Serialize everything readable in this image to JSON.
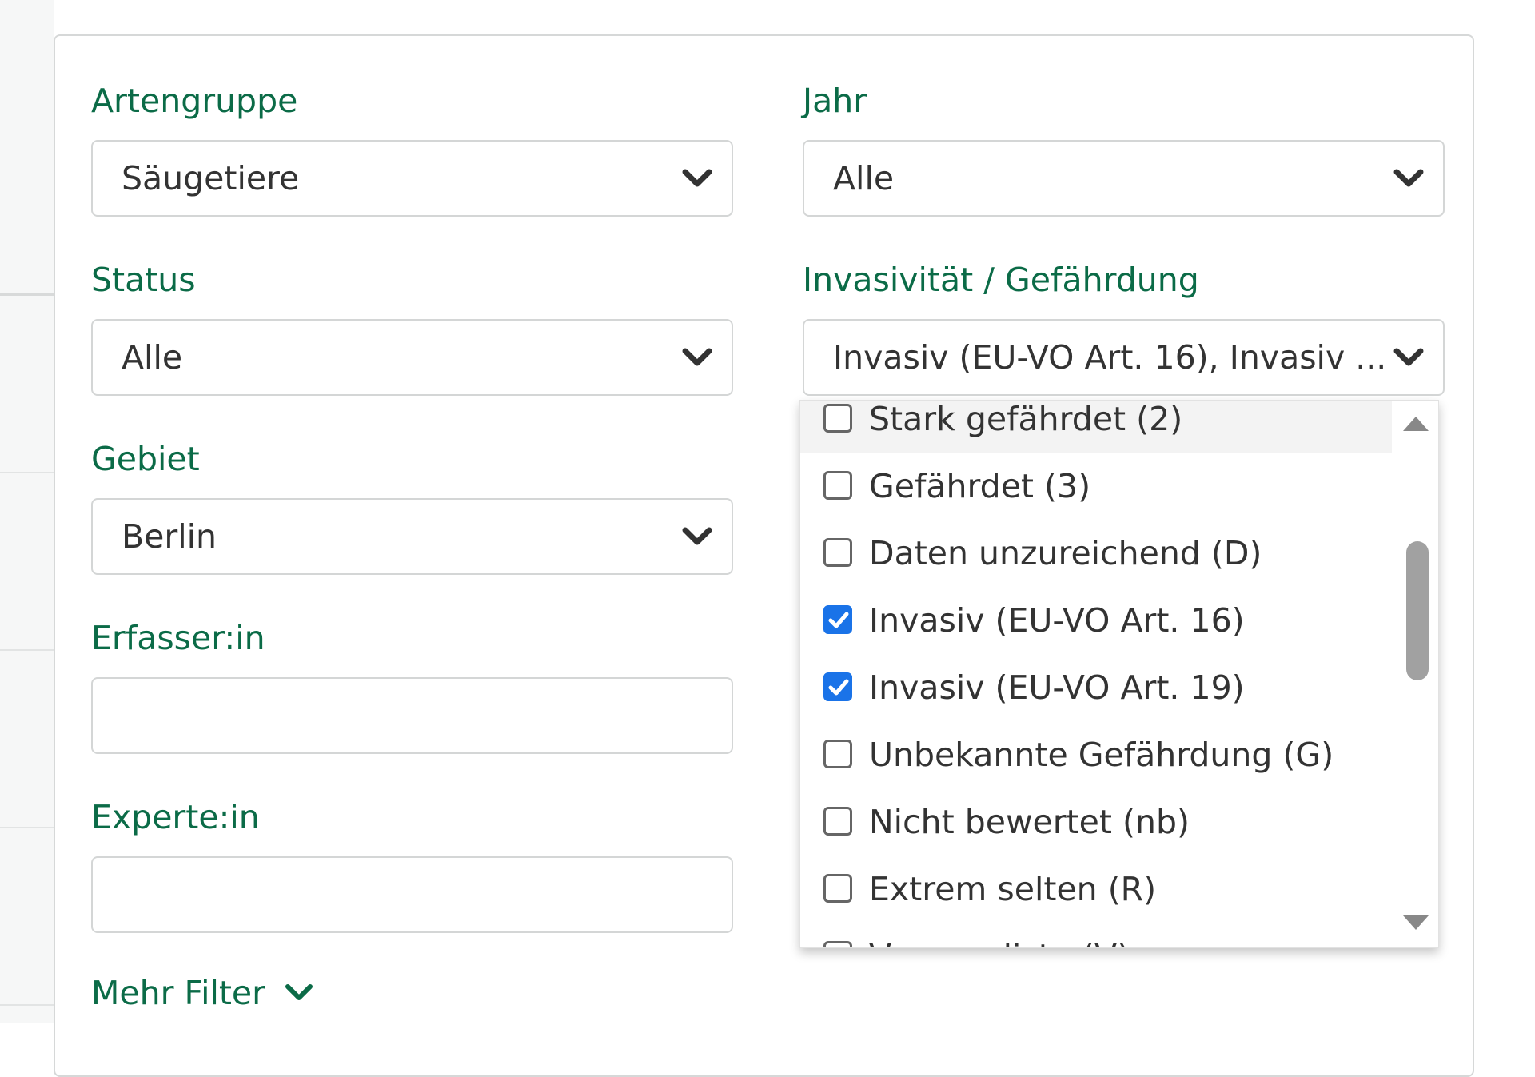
{
  "filters": {
    "artengruppe": {
      "label": "Artengruppe",
      "value": "Säugetiere"
    },
    "jahr": {
      "label": "Jahr",
      "value": "Alle"
    },
    "status": {
      "label": "Status",
      "value": "Alle"
    },
    "invasivitaet": {
      "label": "Invasivität / Gefährdung",
      "value": "Invasiv (EU-VO Art. 16), Invasiv ..."
    },
    "gebiet": {
      "label": "Gebiet",
      "value": "Berlin"
    },
    "erfasser": {
      "label": "Erfasser:in",
      "value": ""
    },
    "experte": {
      "label": "Experte:in",
      "value": ""
    }
  },
  "dropdown": {
    "options": [
      {
        "label": "Stark gefährdet (2)",
        "checked": false
      },
      {
        "label": "Gefährdet (3)",
        "checked": false
      },
      {
        "label": "Daten unzureichend (D)",
        "checked": false
      },
      {
        "label": "Invasiv (EU-VO Art. 16)",
        "checked": true
      },
      {
        "label": "Invasiv (EU-VO Art. 19)",
        "checked": true
      },
      {
        "label": "Unbekannte Gefährdung (G)",
        "checked": false
      },
      {
        "label": "Nicht bewertet (nb)",
        "checked": false
      },
      {
        "label": "Extrem selten (R)",
        "checked": false
      },
      {
        "label": "Vorwarnliste (V)",
        "checked": false
      }
    ]
  },
  "more_filters": {
    "label": "Mehr Filter",
    "icon": "chevron-down-icon"
  },
  "colors": {
    "accent": "#0b6b47",
    "checkbox": "#1a73e8"
  }
}
